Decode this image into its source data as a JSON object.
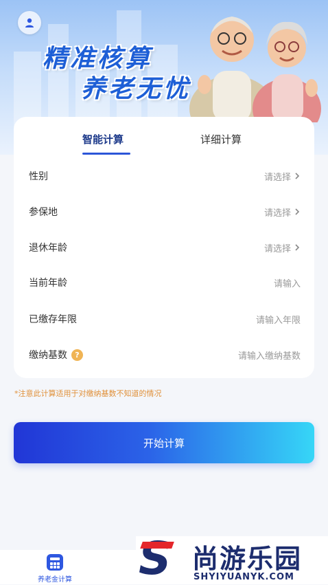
{
  "banner": {
    "slogan_line1": "精准核算",
    "slogan_line2": "养老无忧"
  },
  "tabs": [
    {
      "label": "智能计算",
      "active": true
    },
    {
      "label": "详细计算",
      "active": false
    }
  ],
  "form": {
    "rows": [
      {
        "label": "性别",
        "value": "请选择",
        "type": "select"
      },
      {
        "label": "参保地",
        "value": "请选择",
        "type": "select"
      },
      {
        "label": "退休年龄",
        "value": "请选择",
        "type": "select"
      },
      {
        "label": "当前年龄",
        "value": "请输入",
        "type": "input"
      },
      {
        "label": "已缴存年限",
        "value": "请输入年限",
        "type": "input"
      },
      {
        "label": "缴纳基数",
        "value": "请输入缴纳基数",
        "type": "input",
        "help": "?"
      }
    ]
  },
  "note": "*注意此计算适用于对缴纳基数不知道的情况",
  "start_button": "开始计算",
  "bottom_nav": {
    "label": "养老金计算"
  },
  "watermark": {
    "cn": "尚游乐园",
    "en": "SHYIYUANYK.COM",
    "letter": "S"
  },
  "colors": {
    "accent": "#2b55d8",
    "note": "#e0913b",
    "help": "#f0b455"
  }
}
